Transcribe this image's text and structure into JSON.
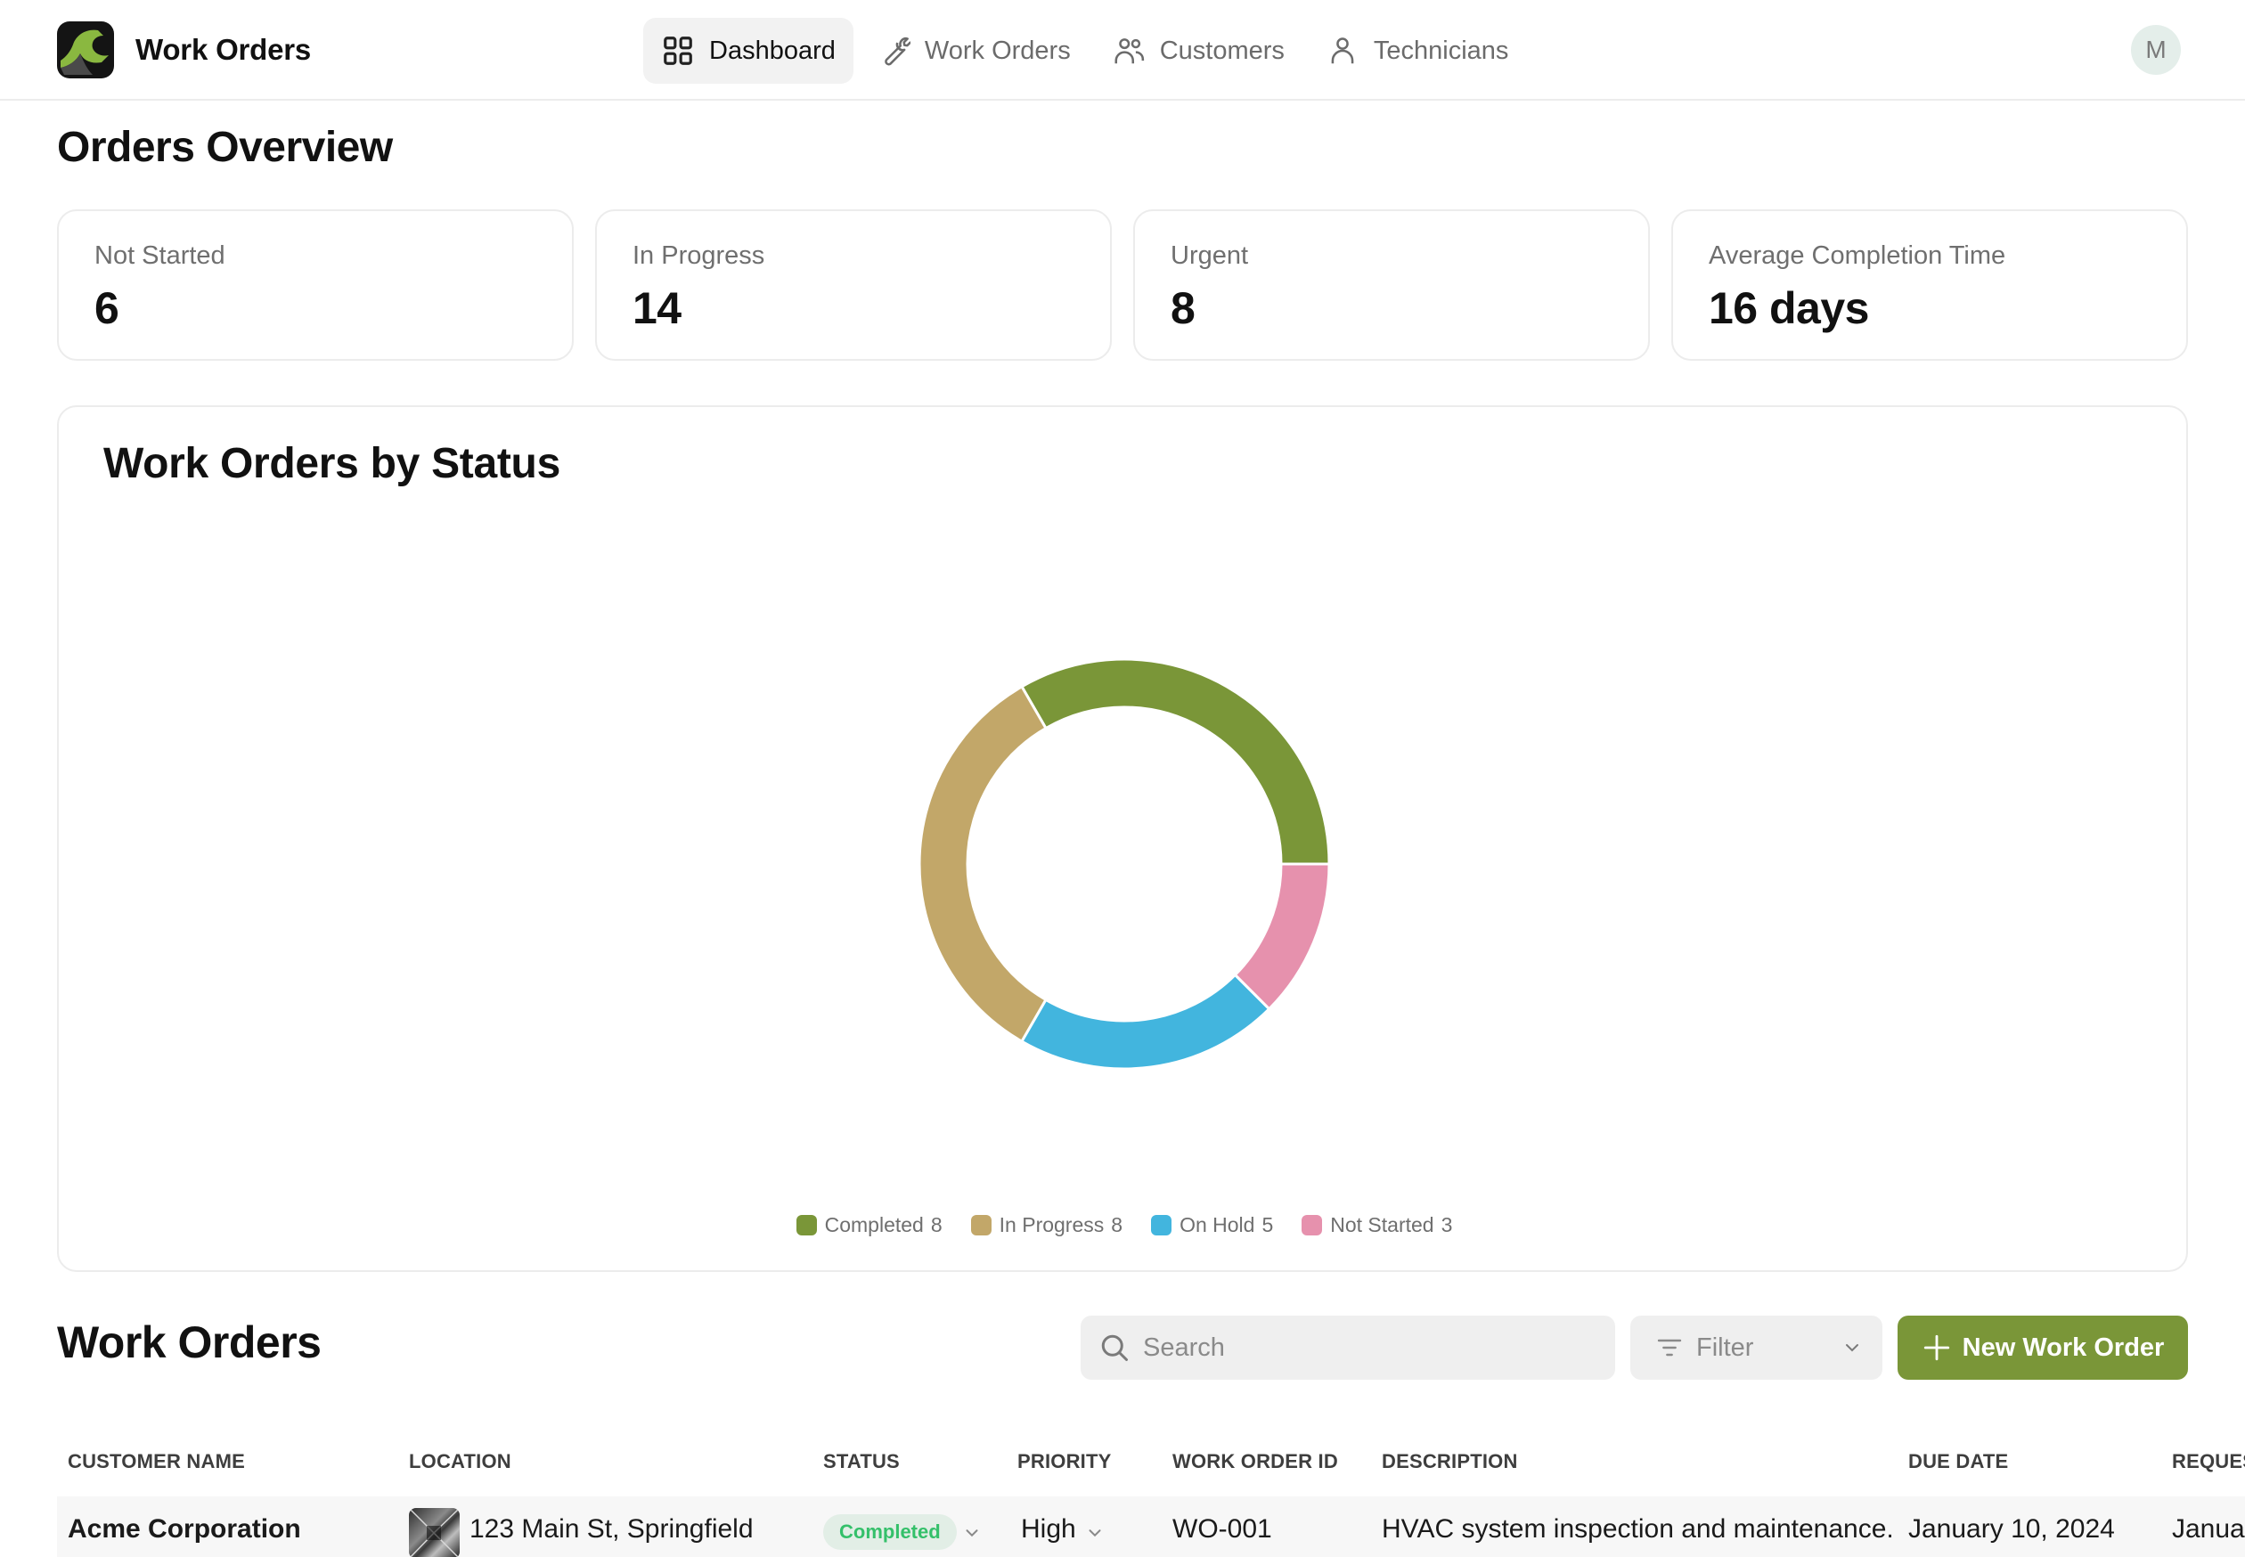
{
  "app": {
    "title": "Work Orders",
    "avatar_initial": "M"
  },
  "nav": {
    "tabs": [
      {
        "label": "Dashboard",
        "icon": "grid-icon",
        "active": true
      },
      {
        "label": "Work Orders",
        "icon": "wrench-icon",
        "active": false
      },
      {
        "label": "Customers",
        "icon": "users-icon",
        "active": false
      },
      {
        "label": "Technicians",
        "icon": "user-icon",
        "active": false
      }
    ]
  },
  "overview": {
    "title": "Orders Overview",
    "cards": [
      {
        "label": "Not Started",
        "value": "6"
      },
      {
        "label": "In Progress",
        "value": "14"
      },
      {
        "label": "Urgent",
        "value": "8"
      },
      {
        "label": "Average Completion Time",
        "value": "16 days"
      }
    ]
  },
  "colors": {
    "accent": "#7a9638",
    "completed": "#7a9638",
    "in_progress": "#c2a769",
    "on_hold": "#42b5de",
    "not_started": "#e691ad",
    "badge_completed_bg": "#e2eee6",
    "badge_completed_fg": "#34c06a"
  },
  "chart_data": {
    "type": "pie",
    "variant": "donut",
    "title": "Work Orders by Status",
    "categories": [
      "Completed",
      "In Progress",
      "On Hold",
      "Not Started"
    ],
    "values": [
      8,
      8,
      5,
      3
    ],
    "colors": [
      "#7a9638",
      "#c2a769",
      "#42b5de",
      "#e691ad"
    ],
    "start_angle": "3 o'clock, counter-clockwise",
    "legend_position": "bottom-center"
  },
  "work_orders": {
    "title": "Work Orders",
    "search_placeholder": "Search",
    "filter_label": "Filter",
    "new_button_label": "New Work Order",
    "columns": [
      "CUSTOMER NAME",
      "LOCATION",
      "STATUS",
      "PRIORITY",
      "WORK ORDER ID",
      "DESCRIPTION",
      "DUE DATE",
      "REQUES"
    ],
    "rows": [
      {
        "customer": "Acme Corporation",
        "location": "123 Main St, Springfield",
        "status": "Completed",
        "priority": "High",
        "id": "WO-001",
        "description": "HVAC system inspection and maintenance.",
        "due_date": "January 10, 2024",
        "requested": "Janua"
      }
    ]
  }
}
